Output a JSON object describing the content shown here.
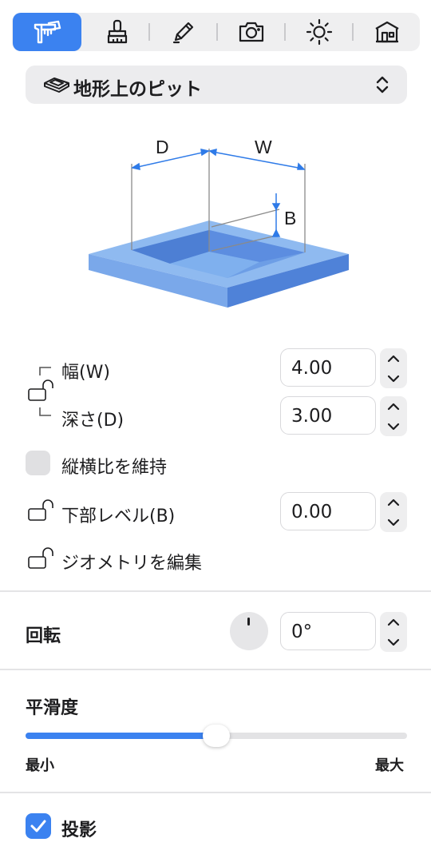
{
  "toolbar": {
    "tabs": [
      {
        "name": "measure",
        "icon": "caliper-ruler-icon",
        "active": true
      },
      {
        "name": "style",
        "icon": "paint-brush-icon",
        "active": false
      },
      {
        "name": "edit",
        "icon": "pencil-icon",
        "active": false
      },
      {
        "name": "camera",
        "icon": "camera-icon",
        "active": false
      },
      {
        "name": "light",
        "icon": "sun-icon",
        "active": false
      },
      {
        "name": "building",
        "icon": "house-icon",
        "active": false
      }
    ]
  },
  "object_type": {
    "label": "地形上のピット",
    "icon": "terrain-pit-icon"
  },
  "diagram": {
    "label_d": "D",
    "label_w": "W",
    "label_b": "B"
  },
  "params": {
    "width_label": "幅(W)",
    "width_value": "4.00",
    "depth_label": "深さ(D)",
    "depth_value": "3.00",
    "aspect_label": "縦横比を維持",
    "aspect_checked": false,
    "bottom_label": "下部レベル(B)",
    "bottom_value": "0.00",
    "edit_geometry_label": "ジオメトリを編集"
  },
  "rotation": {
    "label": "回転",
    "value": "0°"
  },
  "smoothness": {
    "label": "平滑度",
    "min_label": "最小",
    "max_label": "最大",
    "level": 0.5
  },
  "shadow": {
    "label": "投影",
    "checked": true
  },
  "colors": {
    "accent": "#3b82f0",
    "pit_top": "#8fbaf0",
    "pit_dark": "#5b8de0"
  }
}
